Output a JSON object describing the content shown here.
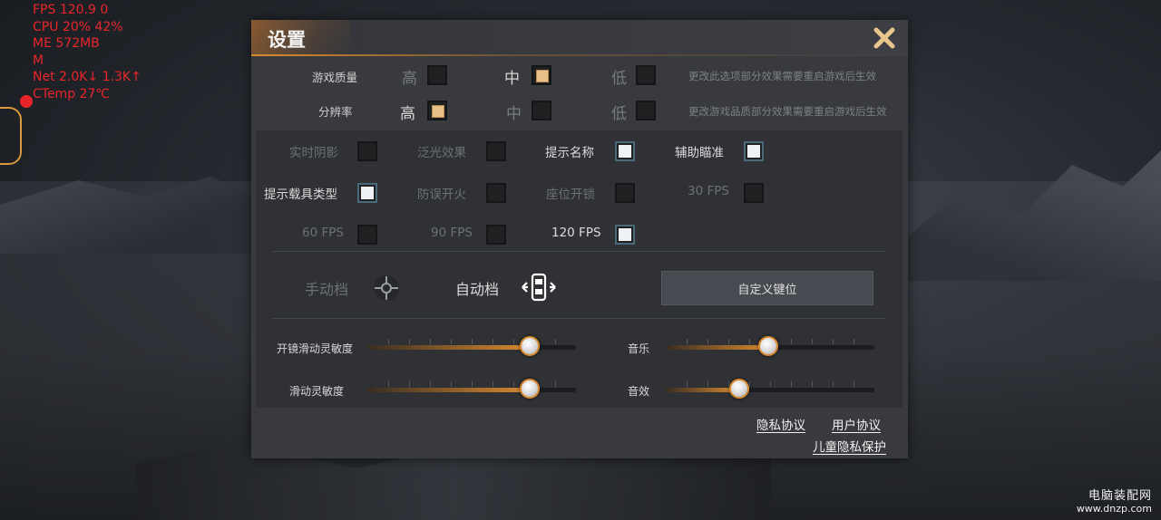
{
  "hud": {
    "lines": [
      "FPS  120.9  0",
      "CPU  20%  42%",
      "ME  572MB",
      "M",
      "Net  2.0K↓  1.3K↑",
      "CTemp  27℃"
    ]
  },
  "watermark": {
    "title": "电脑装配网",
    "url": "www.dnzp.com"
  },
  "dialog": {
    "title": "设置",
    "close_icon": "close-x-icon",
    "game_quality": {
      "label": "游戏质量",
      "options": [
        {
          "label": "高",
          "checked": false
        },
        {
          "label": "中",
          "checked": true
        },
        {
          "label": "低",
          "checked": false
        }
      ],
      "note": "更改此选项部分效果需要重启游戏后生效"
    },
    "resolution": {
      "label": "分辨率",
      "options": [
        {
          "label": "高",
          "checked": true
        },
        {
          "label": "中",
          "checked": false
        },
        {
          "label": "低",
          "checked": false
        }
      ],
      "note": "更改游戏品质部分效果需要重启游戏后生效"
    },
    "toggles": [
      {
        "label": "实时阴影",
        "enabled": false,
        "checked": false
      },
      {
        "label": "泛光效果",
        "enabled": false,
        "checked": false
      },
      {
        "label": "提示名称",
        "enabled": true,
        "checked": true
      },
      {
        "label": "辅助瞄准",
        "enabled": true,
        "checked": true
      },
      {
        "label": "提示载具类型",
        "enabled": true,
        "checked": true
      },
      {
        "label": "防误开火",
        "enabled": false,
        "checked": false
      },
      {
        "label": "座位开锁",
        "enabled": false,
        "checked": false
      },
      {
        "label": "30 FPS",
        "enabled": false,
        "checked": false
      },
      {
        "label": "60 FPS",
        "enabled": false,
        "checked": false
      },
      {
        "label": "90 FPS",
        "enabled": false,
        "checked": false
      },
      {
        "label": "120 FPS",
        "enabled": true,
        "checked": true
      }
    ],
    "modes": {
      "manual_label": "手动档",
      "manual_icon": "crosshair-icon",
      "auto_label": "自动档",
      "auto_icon": "vehicle-arrows-icon",
      "custom_keys_label": "自定义键位"
    },
    "sliders": [
      {
        "label": "开镜滑动灵敏度",
        "value": 0.78
      },
      {
        "label": "滑动灵敏度",
        "value": 0.78
      },
      {
        "label": "音乐",
        "value": 0.49
      },
      {
        "label": "音效",
        "value": 0.35
      }
    ],
    "links": {
      "privacy": "隐私协议",
      "user": "用户协议",
      "child_privacy": "儿童隐私保护"
    }
  }
}
